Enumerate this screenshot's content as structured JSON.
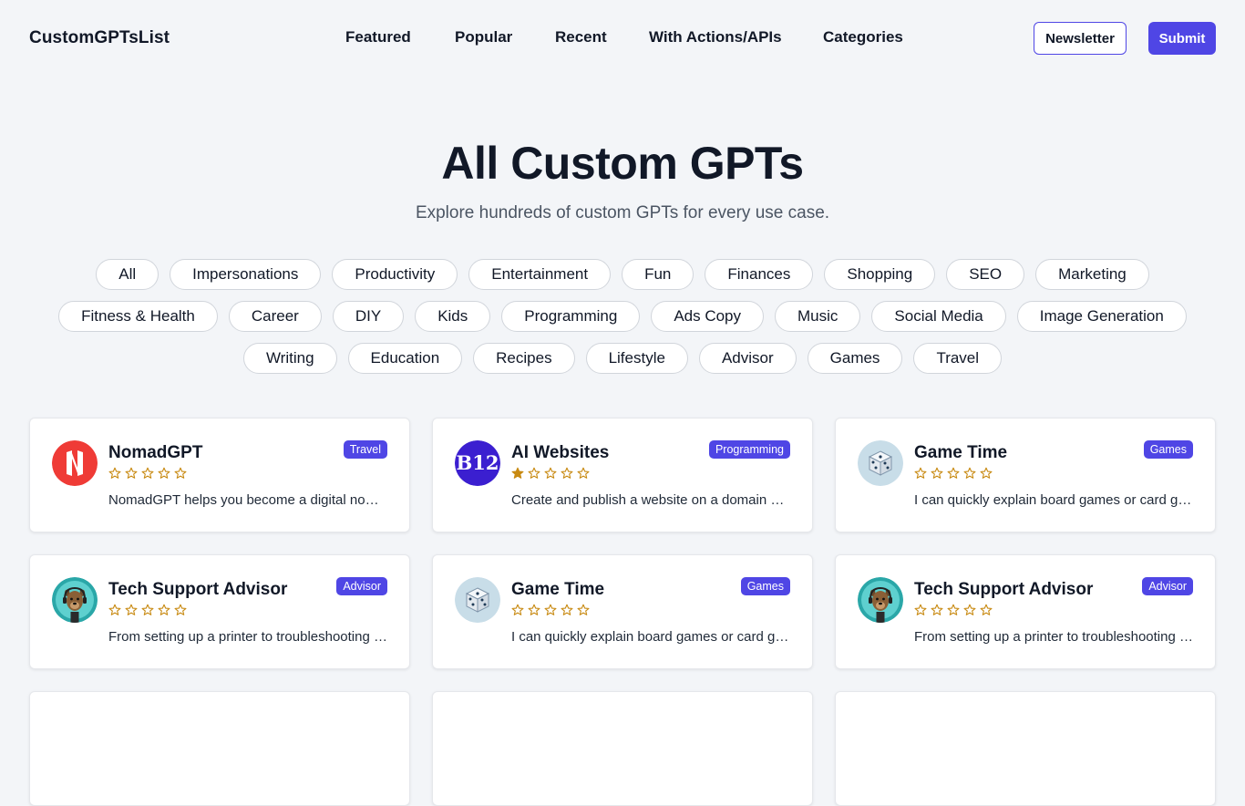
{
  "header": {
    "logo": "CustomGPTsList",
    "nav": [
      "Featured",
      "Popular",
      "Recent",
      "With Actions/APIs",
      "Categories"
    ],
    "newsletter_label": "Newsletter",
    "submit_label": "Submit"
  },
  "hero": {
    "title": "All Custom GPTs",
    "subtitle": "Explore hundreds of custom GPTs for every use case."
  },
  "filters": {
    "rows": [
      [
        "All",
        "Impersonations",
        "Productivity",
        "Entertainment",
        "Fun",
        "Finances",
        "Shopping",
        "SEO",
        "Marketing"
      ],
      [
        "Fitness & Health",
        "Career",
        "DIY",
        "Kids",
        "Programming",
        "Ads Copy",
        "Music",
        "Social Media",
        "Image Generation"
      ],
      [
        "Writing",
        "Education",
        "Recipes",
        "Lifestyle",
        "Advisor",
        "Games",
        "Travel"
      ]
    ]
  },
  "cards": [
    {
      "title": "NomadGPT",
      "category": "Travel",
      "rating": 0,
      "description": "NomadGPT helps you become a digital nomad and find the best places",
      "icon": "nomad-logo-icon"
    },
    {
      "title": "AI Websites",
      "category": "Programming",
      "rating": 1,
      "description": "Create and publish a website on a domain with just a few prompts",
      "icon": "b12-logo-icon"
    },
    {
      "title": "Game Time",
      "category": "Games",
      "rating": 0,
      "description": "I can quickly explain board games or card games to players of any age",
      "icon": "dice-icon"
    },
    {
      "title": "Tech Support Advisor",
      "category": "Advisor",
      "rating": 0,
      "description": "From setting up a printer to troubleshooting a device, I'm here to help",
      "icon": "dog-headset-icon"
    },
    {
      "title": "Game Time",
      "category": "Games",
      "rating": 0,
      "description": "I can quickly explain board games or card games to players of any age",
      "icon": "dice-icon"
    },
    {
      "title": "Tech Support Advisor",
      "category": "Advisor",
      "rating": 0,
      "description": "From setting up a printer to troubleshooting a device, I'm here to help",
      "icon": "dog-headset-icon"
    }
  ],
  "colors": {
    "accent": "#4f46e5",
    "star": "#c88a12",
    "background": "#f3f5f8"
  }
}
